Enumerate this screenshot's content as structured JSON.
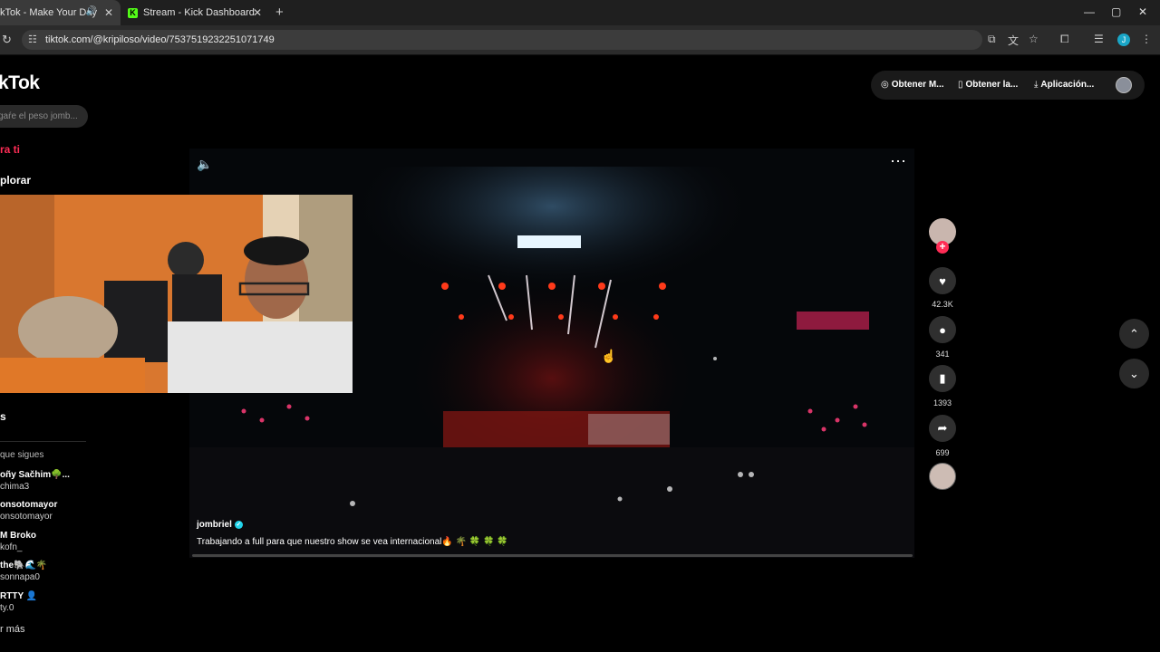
{
  "browser": {
    "tabs": [
      {
        "title": "kTok - Make Your Day",
        "active": true
      },
      {
        "title": "Stream - Kick Dashboard",
        "active": false
      }
    ],
    "url": "tiktok.com/@kripiloso/video/7537519232251071749",
    "profile_initial": "J"
  },
  "tiktok": {
    "logo": "kTok",
    "search_placeholder": "gaŕe el peso jomb...",
    "nav": {
      "for_you": "ra ti",
      "explore": "plorar",
      "lives": "s"
    },
    "following": {
      "title": "que sigues",
      "accounts": [
        {
          "name": "oñy Sačhim🌳...",
          "handle": "chima3"
        },
        {
          "name": "onsotomayor",
          "handle": "onsotomayor"
        },
        {
          "name": "M Broko",
          "handle": "kofn_"
        },
        {
          "name": "the🐘🌊🌴",
          "handle": "sonnapa0"
        },
        {
          "name": "RTTY 👤",
          "handle": "ty.0"
        }
      ],
      "see_more": "r más"
    },
    "header": {
      "btn1": "Obtener M...",
      "btn2": "Obtener la...",
      "btn3": "Aplicación..."
    },
    "video": {
      "author": "jombriel",
      "caption": "Trabajando a full para que nuestro show se vea internacional🔥 🌴 🍀 🍀 🍀",
      "progress": 0.0
    },
    "actions": {
      "likes": "42.3K",
      "comments": "341",
      "saves": "1393",
      "shares": "699"
    }
  }
}
